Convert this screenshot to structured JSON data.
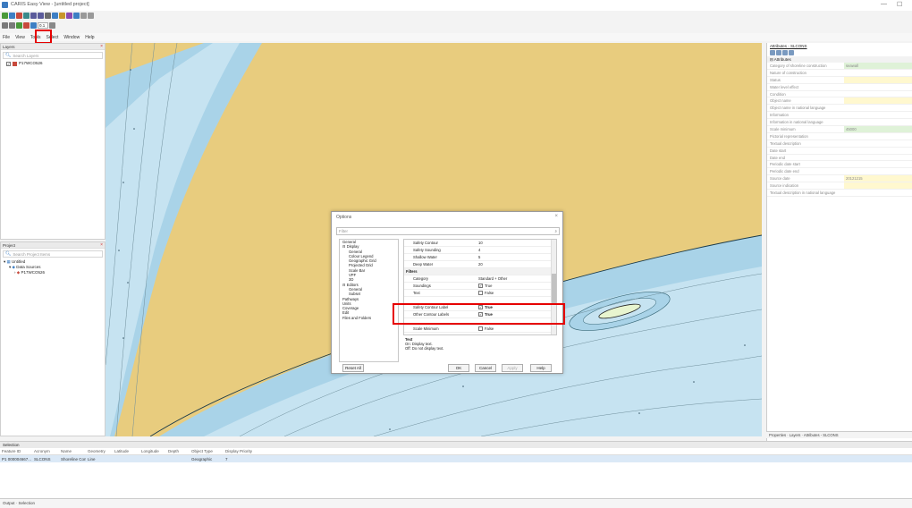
{
  "window": {
    "title": "CARIS Easy View - [untitled project]",
    "min": "—",
    "max": "☐"
  },
  "menu": [
    "File",
    "View",
    "Tools",
    "Select",
    "Window",
    "Help"
  ],
  "scale_box": "0.1",
  "layers": {
    "title": "Layers",
    "search_placeholder": "Search Layers",
    "item": "P17WCO526"
  },
  "project": {
    "title": "Project",
    "search_placeholder": "Search Project Items",
    "items": [
      "Untitled",
      "Data Sources",
      "P17WCO526"
    ]
  },
  "attributes": {
    "title": "Attributes - SLCONS",
    "section": "Attributes",
    "rows": [
      {
        "k": "Category of shoreline construction",
        "v": "seawall"
      },
      {
        "k": "Nature of construction",
        "v": ""
      },
      {
        "k": "Status",
        "v": ""
      },
      {
        "k": "Water level effect",
        "v": ""
      },
      {
        "k": "Condition",
        "v": ""
      },
      {
        "k": "Object name",
        "v": ""
      },
      {
        "k": "Object name in national language",
        "v": ""
      },
      {
        "k": "Information",
        "v": ""
      },
      {
        "k": "Information in national language",
        "v": ""
      },
      {
        "k": "Scale minimum",
        "v": "45000"
      },
      {
        "k": "Pictorial representation",
        "v": ""
      },
      {
        "k": "Textual description",
        "v": ""
      },
      {
        "k": "Date start",
        "v": ""
      },
      {
        "k": "Date end",
        "v": ""
      },
      {
        "k": "Periodic date start",
        "v": ""
      },
      {
        "k": "Periodic date end",
        "v": ""
      },
      {
        "k": "Source date",
        "v": "20121215"
      },
      {
        "k": "Source indication",
        "v": ""
      },
      {
        "k": "Textual description in national language",
        "v": ""
      }
    ],
    "tabs": "Properties · Layers · Attributes - SLCONS"
  },
  "selection": {
    "title": "Selection",
    "headers": [
      "Feature ID",
      "Acronym",
      "Name",
      "Geometry",
      "Latitude",
      "Longitude",
      "Depth",
      "Object Type",
      "Display Priority"
    ],
    "row": [
      "P1 000004667...",
      "SLCONS",
      "Shoreline Con...",
      "Line",
      "",
      "",
      "",
      "Geographic",
      "7"
    ]
  },
  "bottom_tabs": "Output · Selection",
  "dialog": {
    "title": "Options",
    "filter": "Filter",
    "tree": [
      "General",
      "Display",
      "General",
      "Colour Legend",
      "Geographic Grid",
      "Projected Grid",
      "Scale Bar",
      "VPF",
      "3D",
      "Editors",
      "General",
      "Subset",
      "Pathways",
      "Units",
      "Coverage",
      "Edit",
      "Files and Folders"
    ],
    "grid": [
      {
        "k": "Safety Contour",
        "v": "10",
        "type": "text"
      },
      {
        "k": "Safety Sounding",
        "v": "4",
        "type": "text"
      },
      {
        "k": "Shallow Water",
        "v": "5",
        "type": "text"
      },
      {
        "k": "Deep Water",
        "v": "20",
        "type": "text"
      },
      {
        "k": "Filters",
        "v": "",
        "type": "section"
      },
      {
        "k": "Category",
        "v": "Standard + Other",
        "type": "text"
      },
      {
        "k": "Soundings",
        "v": "True",
        "type": "check",
        "checked": true
      },
      {
        "k": "Text",
        "v": "False",
        "type": "check",
        "checked": false
      },
      {
        "k": "",
        "v": "",
        "type": "blank"
      },
      {
        "k": "Safety Contour Label",
        "v": "True",
        "type": "check",
        "checked": true,
        "bold": true
      },
      {
        "k": "Other Contour Labels",
        "v": "True",
        "type": "check",
        "checked": true,
        "bold": true
      },
      {
        "k": "",
        "v": "",
        "type": "blank"
      },
      {
        "k": "Scale Minimum",
        "v": "False",
        "type": "check",
        "checked": false
      }
    ],
    "desc_title": "Text",
    "desc_lines": [
      "On: Display text.",
      "Off: Do not display text."
    ],
    "buttons": {
      "reset": "Reset All",
      "ok": "OK",
      "cancel": "Cancel",
      "apply": "Apply",
      "help": "Help"
    }
  },
  "colors": {
    "land": "#e8cc7e",
    "water": "#a9d3e8",
    "highlight": "#e60000"
  }
}
